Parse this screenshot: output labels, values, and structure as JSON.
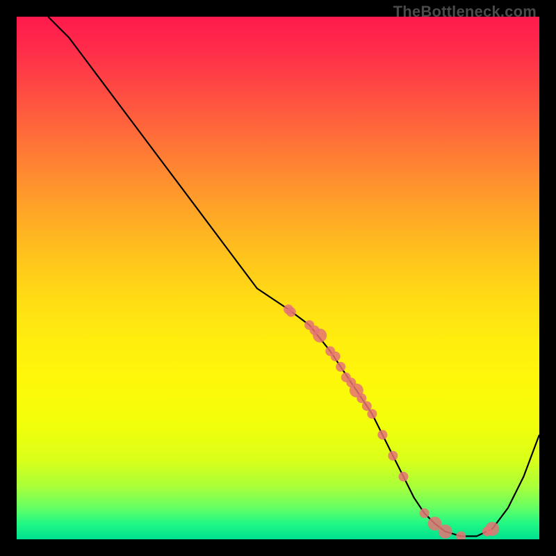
{
  "watermark": "TheBottleneck.com",
  "chart_data": {
    "type": "line",
    "title": "",
    "xlabel": "",
    "ylabel": "",
    "xlim": [
      0,
      100
    ],
    "ylim": [
      0,
      100
    ],
    "grid": false,
    "legend": false,
    "background_gradient": {
      "top": "#ff1a4d",
      "middle": "#ffee0e",
      "bottom": "#00e090"
    },
    "series": [
      {
        "name": "bottleneck-curve",
        "x": [
          6,
          10,
          16,
          22,
          28,
          34,
          40,
          46,
          52,
          56,
          60,
          64,
          68,
          72,
          74,
          76,
          78,
          80,
          82,
          85,
          88,
          91,
          94,
          97,
          100
        ],
        "y": [
          100,
          96,
          88,
          80,
          72,
          64,
          56,
          48,
          44,
          41,
          36,
          30,
          24,
          16,
          12,
          8,
          5,
          3,
          1.5,
          0.6,
          0.6,
          2,
          6,
          12,
          20
        ]
      }
    ],
    "scatter_points": {
      "name": "highlighted-points",
      "x": [
        52,
        52.5,
        56,
        57,
        58,
        60,
        61,
        62,
        63,
        64,
        65,
        66,
        67,
        68,
        70,
        72,
        74,
        78,
        80,
        82,
        85,
        90,
        91
      ],
      "y": [
        44,
        43.5,
        41,
        40,
        39,
        36,
        35,
        33,
        31,
        30,
        28.5,
        27,
        25.5,
        24,
        20,
        16,
        12,
        5,
        3,
        1.5,
        0.6,
        1.5,
        2
      ],
      "radius_default": 7,
      "radius_large_indices": [
        4,
        10,
        18,
        19,
        22
      ]
    }
  }
}
